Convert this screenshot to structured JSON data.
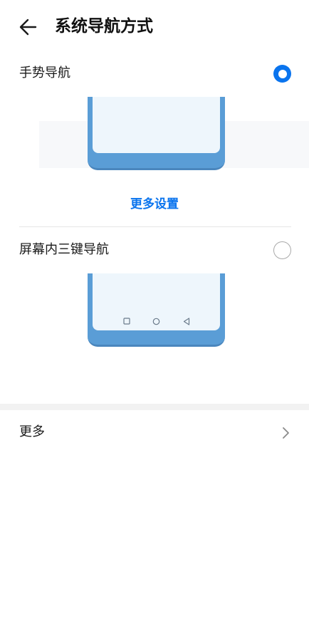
{
  "header": {
    "back_icon": "arrow-left-icon",
    "title": "系统导航方式"
  },
  "options": [
    {
      "label": "手势导航",
      "selected": true,
      "link_label": "更多设置"
    },
    {
      "label": "屏幕内三键导航",
      "selected": false,
      "nav_keys": [
        "square-icon",
        "circle-icon",
        "triangle-left-icon"
      ]
    }
  ],
  "more": {
    "label": "更多",
    "chevron_icon": "chevron-right-icon"
  },
  "colors": {
    "accent": "#0a74ee",
    "phone_frame": "#5a9dd6",
    "phone_screen": "#eef6fc",
    "divider": "#e6e6e6",
    "section_gap": "#f2f2f2"
  }
}
